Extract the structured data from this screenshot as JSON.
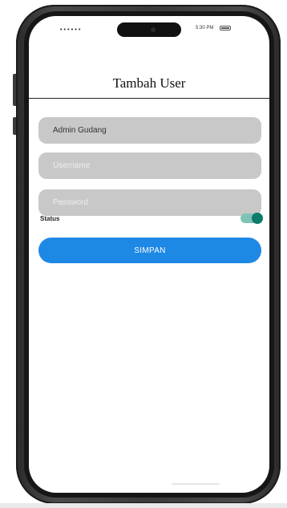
{
  "status_bar": {
    "signal": "••••••",
    "time": "5:30 PM",
    "battery_icon": "battery-icon"
  },
  "header": {
    "title": "Tambah User"
  },
  "form": {
    "role_value": "Admin Gudang",
    "username_placeholder": "Username",
    "password_placeholder": "Password",
    "status_label": "Status",
    "status_on": true,
    "save_label": "SIMPAN"
  },
  "colors": {
    "field_bg": "#c8c8c8",
    "button_bg": "#1e88e5",
    "toggle_track": "#7ec3b6",
    "toggle_knob": "#0d7b6b",
    "phone_frame": "#2b2b2b"
  }
}
